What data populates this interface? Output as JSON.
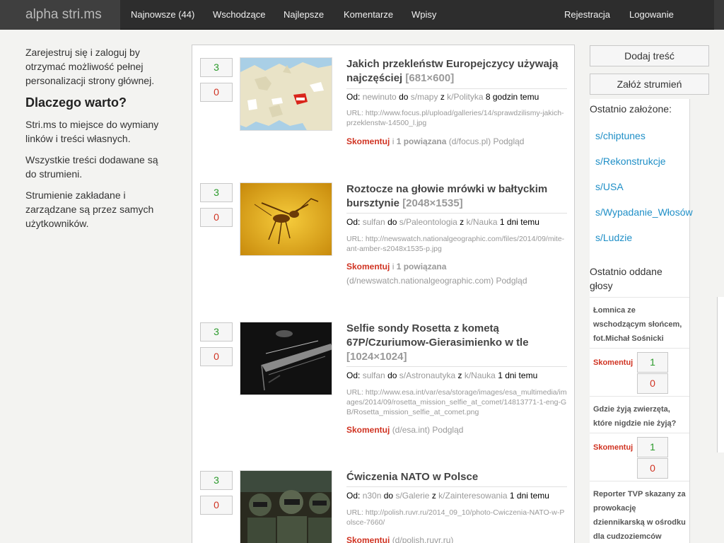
{
  "nav": {
    "brand": "alpha stri.ms",
    "items": [
      "Najnowsze (44)",
      "Wschodzące",
      "Najlepsze",
      "Komentarze",
      "Wpisy"
    ],
    "register": "Rejestracja",
    "login": "Logowanie"
  },
  "intro": {
    "p1": "Zarejestruj się i zaloguj by otrzymać możliwość pełnej personalizacji strony głównej.",
    "heading": "Dlaczego warto?",
    "p2": "Stri.ms to miejsce do wymiany linków i treści własnych.",
    "p3": "Wszystkie treści dodawane są do strumieni.",
    "p4": "Strumienie zakładane i zarządzane są przez samych użytkowników."
  },
  "posts": [
    {
      "up": "3",
      "down": "0",
      "title": "Jakich przekleństw Europejczycy używają najczęściej",
      "dims": "[681×600]",
      "from_label": "Od:",
      "user": "newinuto",
      "do_label": "do",
      "stream": "s/mapy",
      "z_label": "z",
      "category": "k/Polityka",
      "time": "8 godzin temu",
      "url": "URL: http://www.focus.pl/upload/galleries/14/sprawdzilismy-jakich-przeklenstw-14500_l.jpg",
      "comment": "Skomentuj",
      "sep": "i",
      "related": "1 powiązana",
      "domain": "(d/focus.pl)",
      "preview": "Podgląd"
    },
    {
      "up": "3",
      "down": "0",
      "title": "Roztocze na głowie mrówki w bałtyckim bursztynie",
      "dims": "[2048×1535]",
      "from_label": "Od:",
      "user": "sulfan",
      "do_label": "do",
      "stream": "s/Paleontologia",
      "z_label": "z",
      "category": "k/Nauka",
      "time": "1 dni temu",
      "url": "URL: http://newswatch.nationalgeographic.com/files/2014/09/mite-ant-amber-s2048x1535-p.jpg",
      "comment": "Skomentuj",
      "sep": "i",
      "related": "1 powiązana",
      "domain": "(d/newswatch.nationalgeographic.com)",
      "preview": "Podgląd"
    },
    {
      "up": "3",
      "down": "0",
      "title": "Selfie sondy Rosetta z kometą 67P/Czuriumow-Gierasimienko w tle",
      "dims": "[1024×1024]",
      "from_label": "Od:",
      "user": "sulfan",
      "do_label": "do",
      "stream": "s/Astronautyka",
      "z_label": "z",
      "category": "k/Nauka",
      "time": "1 dni temu",
      "url": "URL: http://www.esa.int/var/esa/storage/images/esa_multimedia/images/2014/09/rosetta_mission_selfie_at_comet/14813771-1-eng-GB/Rosetta_mission_selfie_at_comet.png",
      "comment": "Skomentuj",
      "domain": "(d/esa.int)",
      "preview": "Podgląd"
    },
    {
      "up": "3",
      "down": "0",
      "title": "Ćwiczenia NATO w Polsce",
      "from_label": "Od:",
      "user": "n30n",
      "do_label": "do",
      "stream": "s/Galerie",
      "z_label": "z",
      "category": "k/Zainteresowania",
      "time": "1 dni temu",
      "url": "URL: http://polish.ruvr.ru/2014_09_10/photo-Cwiczenia-NATO-w-Polsce-7660/",
      "comment": "Skomentuj",
      "domain": "(d/polish.ruvr.ru)"
    }
  ],
  "sidebar": {
    "add_content": "Dodaj treść",
    "create_stream": "Załóż strumień",
    "recent_created_title": "Ostatnio założone:",
    "recent_streams": [
      "s/chiptunes",
      "s/Rekonstrukcje",
      "s/USA",
      "s/Wypadanie_Włosów",
      "s/Ludzie"
    ],
    "recent_votes_title": "Ostatnio oddane głosy",
    "votes": [
      {
        "title": "Łomnica ze wschodzącym słońcem, fot.Michał Sośnicki",
        "comment": "Skomentuj",
        "up": "1",
        "down": "0"
      },
      {
        "title": "Gdzie żyją zwierzęta, które nigdzie nie żyją?",
        "comment": "Skomentuj",
        "up": "1",
        "down": "0"
      },
      {
        "title": "Reporter TVP skazany za prowokację dziennikarską w ośrodku dla cudzoziemców"
      }
    ]
  },
  "colors": {
    "accent_link": "#1f8fc7",
    "up": "#2a9a2a",
    "down": "#d03322",
    "navbar": "#2d2d2d"
  }
}
